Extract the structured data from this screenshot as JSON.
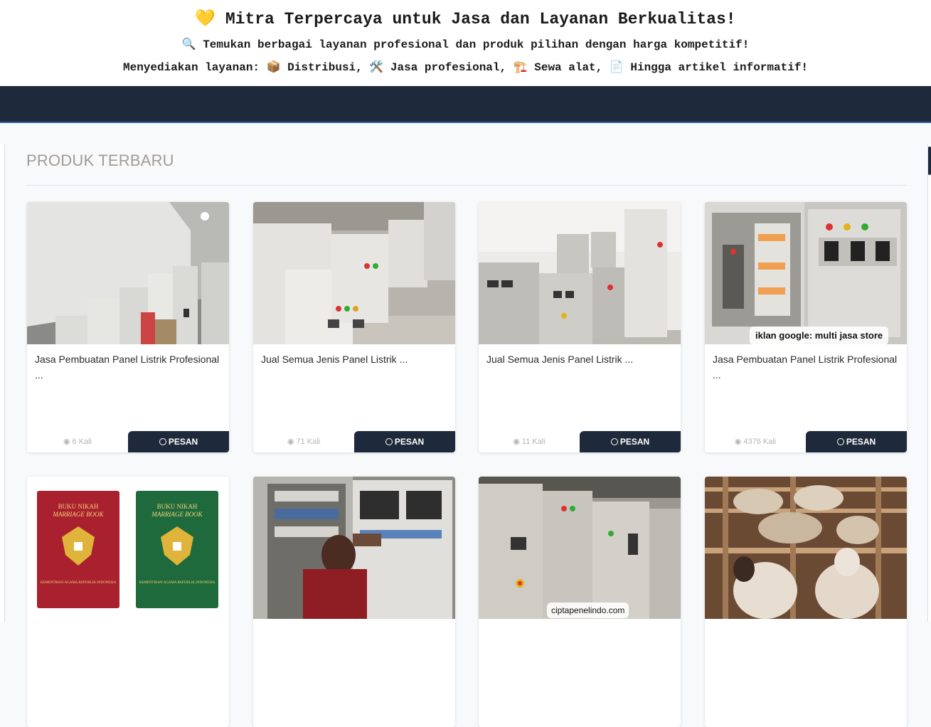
{
  "banner": {
    "line1": "💛 Mitra Terpercaya untuk Jasa dan Layanan Berkualitas!",
    "line2": "🔍 Temukan berbagai layanan profesional dan produk pilihan dengan harga kompetitif!",
    "line3": "Menyediakan layanan: 📦 Distribusi, 🛠️ Jasa profesional, 🏗️ Sewa alat, 📄 Hingga artikel informatif!"
  },
  "section": {
    "title": "PRODUK TERBARU"
  },
  "order_label": "PESAN",
  "products": [
    {
      "title": "Jasa Pembuatan Panel Listrik Profesional ...",
      "views": "6 Kali"
    },
    {
      "title": "Jual Semua Jenis Panel Listrik ...",
      "views": "71 Kali"
    },
    {
      "title": "Jual Semua Jenis Panel Listrik ...",
      "views": "11 Kali"
    },
    {
      "title": "Jasa Pembuatan Panel Listrik Profesional ...",
      "views": "4376 Kali",
      "watermark": "iklan google: multi jasa store"
    },
    {
      "book_red_line1": "BUKU NIKAH",
      "book_red_line2": "MARRIAGE BOOK",
      "book_red_footer": "KEMENTRIAN AGAMA REPUBLIK INDONESIA",
      "book_green_line1": "BUKU NIKAH",
      "book_green_line2": "MARRIAGE BOOK",
      "book_green_footer": "KEMENTRIAN AGAMA REPUBLIK INDONESIA"
    },
    {},
    {
      "watermark": "ciptapenelindo.com"
    },
    {}
  ],
  "colors": {
    "navbar": "#1e293b",
    "button": "#1e293b",
    "section_title": "#a39a94"
  }
}
